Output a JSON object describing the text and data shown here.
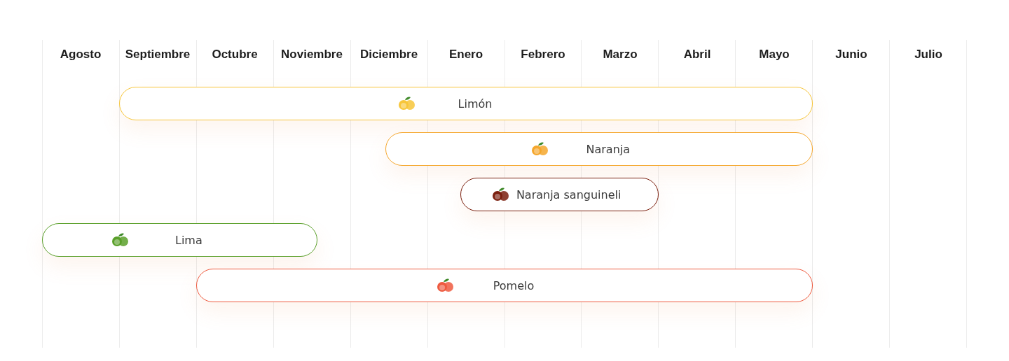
{
  "months": [
    "Agosto",
    "Septiembre",
    "Octubre",
    "Noviembre",
    "Diciembre",
    "Enero",
    "Febrero",
    "Marzo",
    "Abril",
    "Mayo",
    "Junio",
    "Julio"
  ],
  "bars": [
    {
      "label": "Limón",
      "color": "#f7c63a"
    },
    {
      "label": "Naranja",
      "color": "#f5a72d"
    },
    {
      "label": "Naranja sanguineli",
      "color": "#7a1f0e"
    },
    {
      "label": "Lima",
      "color": "#5aa02a"
    },
    {
      "label": "Pomelo",
      "color": "#ee5a3f"
    }
  ]
}
